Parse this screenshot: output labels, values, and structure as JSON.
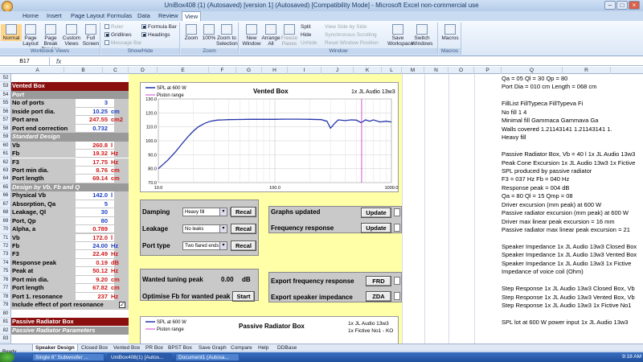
{
  "window": {
    "title": "UniBox408 (1) (Autosaved) [version 1] (Autosaved) [Compatibility Mode] - Microsoft Excel non-commercial use"
  },
  "ribbon": {
    "tabs": [
      "Home",
      "Insert",
      "Page Layout",
      "Formulas",
      "Data",
      "Review",
      "View"
    ],
    "active_tab": "View",
    "workbook_views": {
      "label": "Workbook Views",
      "buttons": [
        "Normal",
        "Page Layout",
        "Page Break Preview",
        "Custom Views",
        "Full Screen"
      ]
    },
    "show_hide": {
      "label": "Show/Hide",
      "items": [
        "Ruler",
        "Formula Bar",
        "Gridlines",
        "Headings",
        "Message Bar"
      ]
    },
    "zoom": {
      "label": "Zoom",
      "buttons": [
        "Zoom",
        "100%",
        "Zoom to Selection"
      ]
    },
    "window": {
      "label": "Window",
      "buttons": [
        "New Window",
        "Arrange All",
        "Freeze Panes",
        "Split",
        "Hide",
        "Unhide",
        "View Side by Side",
        "Synchronous Scrolling",
        "Reset Window Position",
        "Save Workspace",
        "Switch Windows"
      ]
    },
    "macros": {
      "label": "Macros",
      "buttons": [
        "Macros"
      ]
    }
  },
  "formula_bar": {
    "name_box": "B17",
    "fx": "fx"
  },
  "columns": [
    "A",
    "B",
    "C",
    "D",
    "E",
    "F",
    "G",
    "H",
    "I",
    "J",
    "K",
    "L",
    "M",
    "N",
    "O",
    "P",
    "Q",
    "R"
  ],
  "rows": [
    "52",
    "53",
    "54",
    "55",
    "56",
    "57",
    "58",
    "59",
    "60",
    "61",
    "62",
    "63",
    "64",
    "65",
    "66",
    "67",
    "68",
    "69",
    "70",
    "71",
    "72",
    "73",
    "74",
    "75",
    "76",
    "77",
    "78",
    "79",
    "80",
    "81",
    "82",
    "83"
  ],
  "left_panel": {
    "vented_box": "Vented Box",
    "port": "Port",
    "items1": [
      {
        "label": "No of ports",
        "value": "3",
        "unit": "",
        "color": "blue"
      },
      {
        "label": "Inside port dia.",
        "value": "10.25",
        "unit": "cm",
        "color": "blue"
      },
      {
        "label": "Port area",
        "value": "247.55",
        "unit": "cm2",
        "color": "red"
      },
      {
        "label": "Port end correction",
        "value": "0.732",
        "unit": "",
        "color": "blue"
      }
    ],
    "standard_design": "Standard Design",
    "items2": [
      {
        "label": "Vb",
        "value": "260.8",
        "unit": "l",
        "color": "red"
      },
      {
        "label": "Fb",
        "value": "19.32",
        "unit": "Hz",
        "color": "red"
      },
      {
        "label": "F3",
        "value": "17.75",
        "unit": "Hz",
        "color": "red"
      },
      {
        "label": "Port min dia.",
        "value": "8.76",
        "unit": "cm",
        "color": "red"
      },
      {
        "label": "Port length",
        "value": "69.14",
        "unit": "cm",
        "color": "red"
      }
    ],
    "design_by": "Design by Vb, Fb and Q",
    "items3": [
      {
        "label": "Physical Vb",
        "value": "142.0",
        "unit": "l",
        "color": "blue"
      },
      {
        "label": "Absorption, Qa",
        "value": "5",
        "unit": "",
        "color": "blue"
      },
      {
        "label": "Leakage, Ql",
        "value": "30",
        "unit": "",
        "color": "blue"
      },
      {
        "label": "Port, Qp",
        "value": "80",
        "unit": "",
        "color": "blue"
      },
      {
        "label": "Alpha, a",
        "value": "0.789",
        "unit": "",
        "color": "red"
      },
      {
        "label": "Vb",
        "value": "172.0",
        "unit": "l",
        "color": "red"
      },
      {
        "label": "Fb",
        "value": "24.00",
        "unit": "Hz",
        "color": "blue"
      },
      {
        "label": "F3",
        "value": "22.49",
        "unit": "Hz",
        "color": "red"
      },
      {
        "label": "Response peak",
        "value": "0.19",
        "unit": "dB",
        "color": "red"
      },
      {
        "label": "Peak at",
        "value": "50.12",
        "unit": "Hz",
        "color": "red"
      },
      {
        "label": "Port min dia.",
        "value": "9.20",
        "unit": "cm",
        "color": "red"
      },
      {
        "label": "Port length",
        "value": "67.82",
        "unit": "cm",
        "color": "red"
      },
      {
        "label": "Port 1. resonance",
        "value": "237",
        "unit": "Hz",
        "color": "red"
      }
    ],
    "include_effect": "Include effect of port resonance",
    "passive_radiator_box": "Passive Radiator Box",
    "passive_radiator_params": "Passive Radiator Parameters"
  },
  "chart1": {
    "title": "Vented Box",
    "driver": "1x JL Audio 13w3",
    "legend": [
      "SPL at 600 W",
      "Piston range"
    ]
  },
  "chart_data": {
    "type": "line",
    "xscale": "log",
    "xlim": [
      10,
      1000
    ],
    "ylim": [
      70,
      130
    ],
    "yticks": [
      70,
      80,
      90,
      100,
      110,
      120,
      130
    ],
    "xticks": [
      "10.0",
      "100.0",
      "1000.0"
    ],
    "series": [
      {
        "name": "SPL at 600 W",
        "color": "#2233aa",
        "x": [
          10,
          12,
          14,
          16,
          18,
          20,
          22,
          25,
          28,
          32,
          36,
          40,
          50,
          60,
          80,
          100,
          120,
          150,
          200,
          250,
          280,
          300,
          330,
          350,
          400,
          450,
          500,
          550,
          600,
          650,
          700,
          800,
          900,
          1000
        ],
        "y": [
          80,
          86,
          92,
          98,
          103,
          107,
          110,
          112.5,
          114,
          114.8,
          115,
          115.2,
          115.3,
          115.4,
          115.4,
          115.4,
          115.5,
          115.5,
          115.4,
          115.2,
          114,
          109,
          113,
          115,
          114.5,
          115,
          114.8,
          113,
          115,
          114,
          115,
          113.5,
          114,
          113.5
        ]
      },
      {
        "name": "Piston range",
        "color": "#cc44cc",
        "x": [
          555,
          555
        ],
        "y": [
          70,
          130
        ]
      }
    ]
  },
  "chart2": {
    "title": "Passive Radiator Box",
    "driver": "1x JL Audio 13w3",
    "driver2": "1x Fictive No1 - KO",
    "legend": [
      "SPL at 600 W",
      "Piston range"
    ]
  },
  "controls": {
    "damping": {
      "label": "Damping",
      "value": "Heavy fill",
      "button": "Recal"
    },
    "leakage": {
      "label": "Leakage",
      "value": "No leaks",
      "button": "Recal"
    },
    "port_type": {
      "label": "Port type",
      "value": "Two flared ends",
      "button": "Recal"
    },
    "graphs_updated": {
      "label": "Graphs updated",
      "button": "Update"
    },
    "freq_response": {
      "label": "Frequency response",
      "button": "Update"
    },
    "wanted_tuning": {
      "label": "Wanted tuning peak",
      "value": "0.00",
      "unit": "dB"
    },
    "optimise": {
      "label": "Optimise Fb for wanted peak",
      "button": "Start"
    },
    "export_freq": {
      "label": "Export frequency response",
      "button": "FRD"
    },
    "export_imp": {
      "label": "Export speaker impedance",
      "button": "ZDA"
    }
  },
  "right_col": [
    "Qa = 05  Ql = 30  Qp = 80",
    "Port Dia = 010 cm  Length = 068 cm",
    "",
    "FillList          FillTypeca       FillTypeva       Fi",
    "No fill                       1                      4",
    "Minimal fill      Gammaca        Gammava       Ga",
    "Walls covered    1.21143141    1.21143141    1.",
    "Heavy fill",
    "",
    "Passive Radiator Box, Vb = 40 l 1x JL Audio 13w3",
    "Peak Cone Excursion 1x JL Audio 13w3 1x Fictive",
    "SPL produced by passive radiator",
    "F3 = 037 Hz  Fb = 040 Hz",
    "Response peak = 004 dB",
    "Qa = 80  Ql = 15  Qmp = 08",
    "Driver excursion (mm peak) at 600 W",
    "Passive radiator excursion (mm peak) at 600 W",
    "Driver max linear peak excursion = 16 mm",
    "Passive radiator max linear peak excursion = 21",
    "",
    "Speaker Impedance 1x JL Audio 13w3 Closed Box",
    "Speaker Impedance 1x JL Audio 13w3 Vented Box",
    "Speaker Impedance 1x JL Audio 13w3 1x Fictive",
    "Impedance of voice coil (Ohm)",
    "",
    "Step Response 1x JL Audio 13w3 Closed Box, Vb",
    "Step Response 1x JL Audio 13w3 Vented Box, Vb",
    "Step Response 1x JL Audio 13w3 1x Fictive No1",
    "",
    "SPL lot at 600 W power input 1x JL Audio 13w3"
  ],
  "sheet_tabs": [
    "Speaker Design",
    "Closed Box",
    "Vented Box",
    "PR Box",
    "BPST Box",
    "Save Graph",
    "Compare",
    "Help",
    "DDBase"
  ],
  "active_sheet": "Speaker Design",
  "status": "Ready",
  "taskbar": {
    "items": [
      "Single 6\" Subwoofer ...",
      "UniBox408(1) [Autos...",
      "Document1 (Autosa..."
    ],
    "clock": "9:18 AM"
  }
}
